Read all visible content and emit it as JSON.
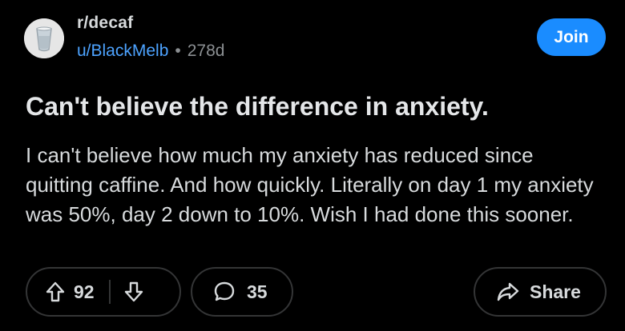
{
  "post": {
    "subreddit": "r/decaf",
    "username": "u/BlackMelb",
    "separator": "•",
    "age": "278d",
    "join_label": "Join",
    "title": "Can't believe the difference in anxiety.",
    "body": "I can't believe how much my anxiety has reduced since quitting caffine. And how quickly. Literally on day 1 my anxiety  was 50%, day 2 down to 10%. Wish I had done this sooner."
  },
  "actions": {
    "vote_count": "92",
    "comment_count": "35",
    "share_label": "Share"
  },
  "icons": {
    "avatar": "subreddit-avatar-icon",
    "upvote": "arrow-up-icon",
    "downvote": "arrow-down-icon",
    "comment": "speech-bubble-icon",
    "share": "share-arrow-icon"
  },
  "colors": {
    "background": "#000000",
    "join_button": "#1a8cff",
    "username": "#4da3ff",
    "muted": "#8b8f92",
    "border": "#343536"
  }
}
